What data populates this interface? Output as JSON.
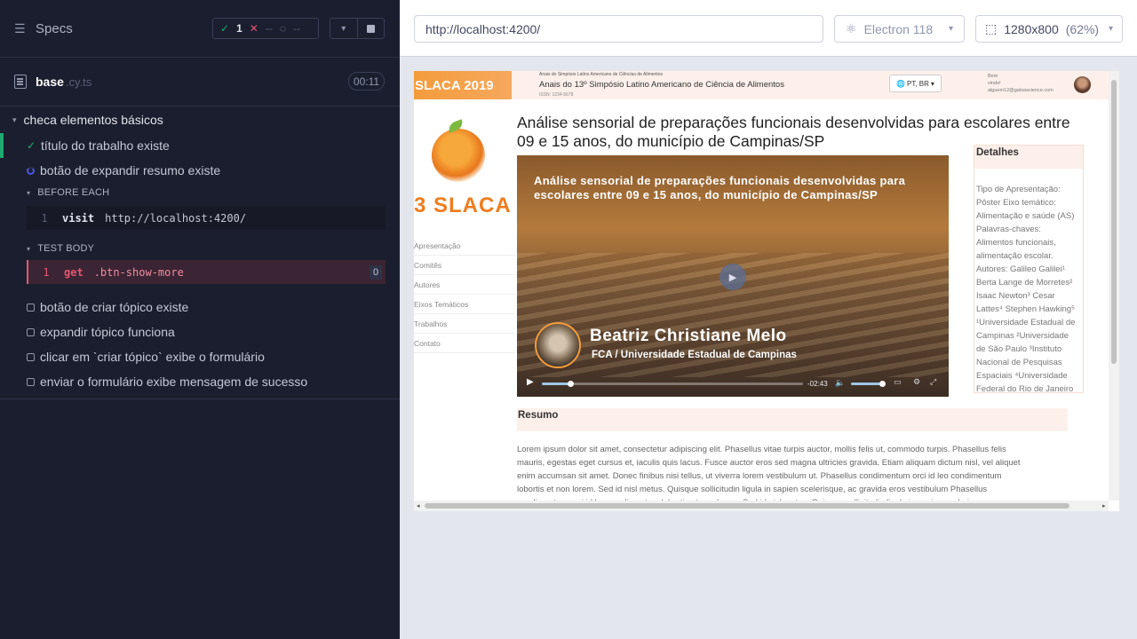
{
  "reporter": {
    "header": {
      "specs_label": "Specs"
    },
    "stats": {
      "passed": "1",
      "failed": "--",
      "pending": "--"
    },
    "file": {
      "name": "base",
      "ext": ".cy.ts",
      "duration": "00:11"
    },
    "suite": {
      "title": "checa elementos básicos",
      "tests": [
        {
          "title": "título do trabalho existe",
          "state": "passed"
        },
        {
          "title": "botão de expandir resumo existe",
          "state": "running"
        },
        {
          "title": "botão de criar tópico existe",
          "state": "pending"
        },
        {
          "title": "expandir tópico funciona",
          "state": "pending"
        },
        {
          "title": "clicar em `criar tópico` exibe o formulário",
          "state": "pending"
        },
        {
          "title": "enviar o formulário exibe mensagem de sucesso",
          "state": "pending"
        }
      ],
      "before_each": {
        "label": "BEFORE EACH",
        "command": {
          "num": "1",
          "name": "visit",
          "message": "http://localhost:4200/"
        }
      },
      "test_body": {
        "label": "TEST BODY",
        "command": {
          "num": "1",
          "name": "get",
          "message": ".btn-show-more",
          "count": "0"
        }
      }
    }
  },
  "toolbar": {
    "url": "http://localhost:4200/",
    "browser": "Electron 118",
    "viewport": "1280x800",
    "zoom": "(62%)"
  },
  "aut": {
    "banner": "SLACA 2019",
    "anais_small": "Anais do Simpósio Latino Americano de Ciências de Alimentos",
    "anais_title": "Anais do 13º Simpósio Latino Americano de Ciência de Alimentos",
    "issn": "ISSN: 1234-5678",
    "lang": "PT, BR",
    "welcome_1": "Bem",
    "welcome_2": "vindo!",
    "welcome_email": "alguem12@galoascience.com",
    "logo_text": "3 SLACA",
    "nav": [
      "Apresentação",
      "Comitês",
      "Autores",
      "Eixos Temáticos",
      "Trabalhos",
      "Contato"
    ],
    "paper_title": "Análise sensorial de preparações funcionais desenvolvidas para escolares entre 09 e 15 anos, do município de Campinas/SP",
    "video": {
      "title": "Análise sensorial de preparações funcionais desenvolvidas para escolares entre 09 e 15 anos, do município de Campinas/SP",
      "speaker_name": "Beatriz Christiane Melo",
      "speaker_inst": "FCA / Universidade Estadual de Campinas",
      "time_left": "-02:43",
      "progress": 0.11,
      "volume": 0.8
    },
    "details": {
      "header": "Detalhes",
      "lines": [
        "Tipo de Apresentação:",
        "Pôster Eixo temático:",
        "Alimentação e saúde (AS)",
        "Palavras-chaves:",
        "Alimentos funcionais,",
        "alimentação escolar.",
        "Autores: Galileo Galilei¹",
        "Berta Lange de Morretes²",
        "Isaac Newton³ Cesar",
        "Lattes⁴ Stephen Hawking⁵",
        "¹Universidade Estadual de",
        "Campinas ²Universidade",
        "de São Paulo ³Instituto",
        "Nacional de Pesquisas",
        "Espaciais ⁴Universidade",
        "Federal do Rio de Janeiro"
      ]
    },
    "resumo": {
      "header": "Resumo",
      "lines": [
        "Lorem ipsum dolor sit amet, consectetur adipiscing elit. Phasellus vitae turpis auctor, mollis felis ut, commodo turpis. Phasellus felis",
        "mauris, egestas eget cursus et, iaculis quis lacus. Fusce auctor eros sed magna ultricies gravida. Etiam aliquam dictum nisl, vel aliquet",
        "enim accumsan sit amet. Donec finibus nisi tellus, ut viverra lorem vestibulum ut. Phasellus condimentum orci id leo condimentum",
        "lobortis et non lorem. Sed id nisl metus. Quisque sollicitudin ligula in sapien scelerisque, ac gravida eros vestibulum Phasellus",
        "condimentum orci id leo condimentum lobortis et non lorem. Sed id nisl metus. Quisque sollicitudin ligula in sapien scelerisque, ac"
      ]
    }
  }
}
